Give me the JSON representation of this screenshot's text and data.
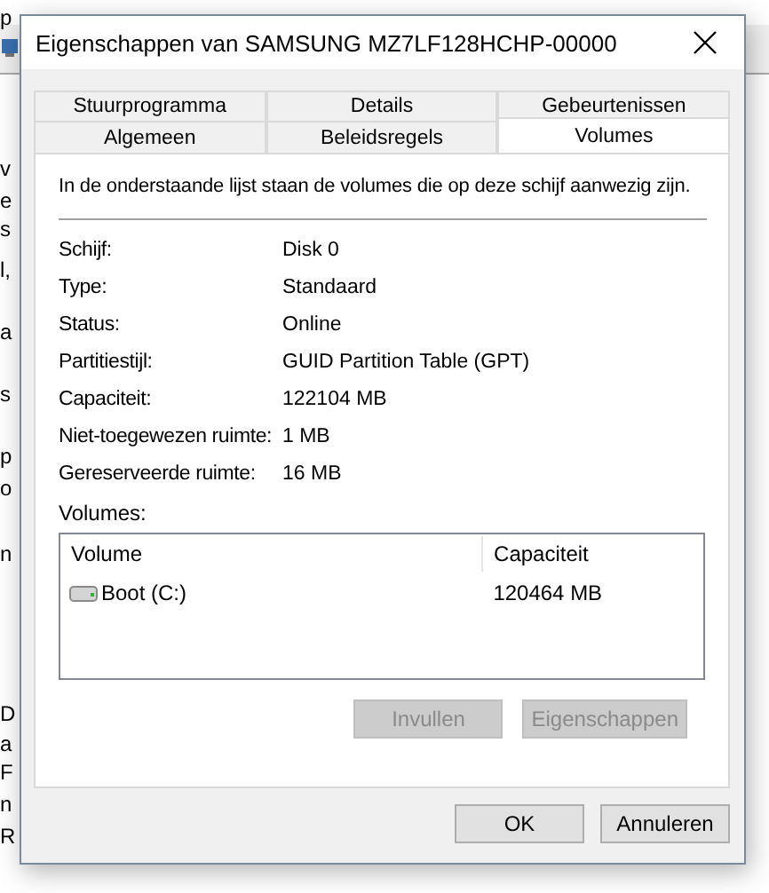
{
  "background_fragments": [
    "p",
    "v",
    "e",
    "s",
    "l,",
    "a",
    "s",
    "p",
    "o",
    "n",
    "D",
    "a",
    "F",
    "n",
    "R"
  ],
  "dialog": {
    "title": "Eigenschappen van SAMSUNG MZ7LF128HCHP-00000",
    "tab_rows": [
      [
        {
          "label": "Stuurprogramma",
          "selected": false
        },
        {
          "label": "Details",
          "selected": false
        },
        {
          "label": "Gebeurtenissen",
          "selected": false
        }
      ],
      [
        {
          "label": "Algemeen",
          "selected": false
        },
        {
          "label": "Beleidsregels",
          "selected": false
        },
        {
          "label": "Volumes",
          "selected": true
        }
      ]
    ],
    "description": "In de onderstaande lijst staan de volumes die op deze schijf aanwezig zijn.",
    "properties": [
      {
        "label": "Schijf:",
        "value": "Disk 0"
      },
      {
        "label": "Type:",
        "value": "Standaard"
      },
      {
        "label": "Status:",
        "value": "Online"
      },
      {
        "label": "Partitiestijl:",
        "value": "GUID Partition Table (GPT)"
      },
      {
        "label": "Capaciteit:",
        "value": "122104 MB"
      },
      {
        "label": "Niet-toegewezen ruimte:",
        "value": "1 MB"
      },
      {
        "label": "Gereserveerde ruimte:",
        "value": "16 MB"
      }
    ],
    "volumes_label": "Volumes:",
    "volumes_table": {
      "columns": [
        "Volume",
        "Capaciteit"
      ],
      "rows": [
        {
          "volume": "Boot (C:)",
          "capacity": "120464 MB",
          "selected": false
        }
      ]
    },
    "panel_buttons": [
      {
        "label": "Invullen",
        "disabled": true
      },
      {
        "label": "Eigenschappen",
        "disabled": true
      }
    ],
    "buttons": [
      {
        "label": "OK",
        "disabled": false
      },
      {
        "label": "Annuleren",
        "disabled": false
      }
    ]
  }
}
